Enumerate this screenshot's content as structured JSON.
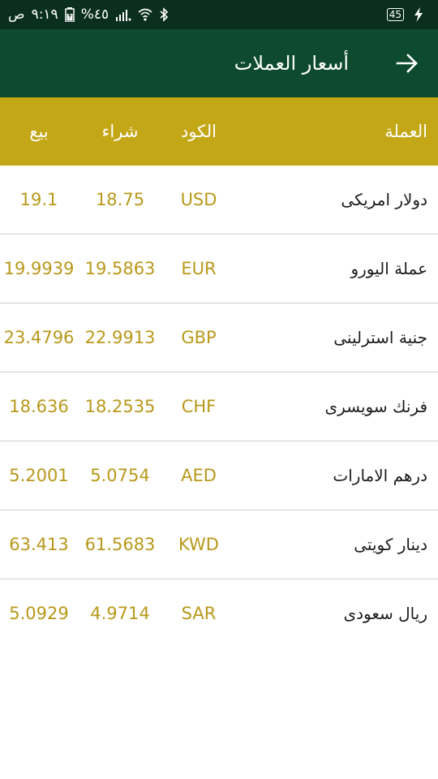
{
  "status_bar": {
    "time": "٩:١٩",
    "ampm": "ص",
    "battery_percent": "%٤٥",
    "right_badge": "45"
  },
  "app_bar": {
    "title": "أسعار العملات",
    "back_icon": "arrow-right-icon"
  },
  "table": {
    "headers": {
      "currency": "العملة",
      "code": "الكود",
      "buy": "شراء",
      "sell": "بيع"
    },
    "rows": [
      {
        "name": "دولار امريكى",
        "code": "USD",
        "buy": "18.75",
        "sell": "19.1"
      },
      {
        "name": "عملة اليورو",
        "code": "EUR",
        "buy": "19.5863",
        "sell": "19.9939"
      },
      {
        "name": "جنية استرلينى",
        "code": "GBP",
        "buy": "22.9913",
        "sell": "23.4796"
      },
      {
        "name": "فرنك سويسرى",
        "code": "CHF",
        "buy": "18.2535",
        "sell": "18.636"
      },
      {
        "name": "درهم الامارات",
        "code": "AED",
        "buy": "5.0754",
        "sell": "5.2001"
      },
      {
        "name": "دينار كويتى",
        "code": "KWD",
        "buy": "61.5683",
        "sell": "63.413"
      },
      {
        "name": "ريال سعودى",
        "code": "SAR",
        "buy": "4.9714",
        "sell": "5.0929"
      }
    ]
  },
  "colors": {
    "status_bar": "#0a2f1f",
    "app_bar": "#0d4a2e",
    "header_gold": "#c3a716",
    "value_gold": "#b8981a"
  }
}
